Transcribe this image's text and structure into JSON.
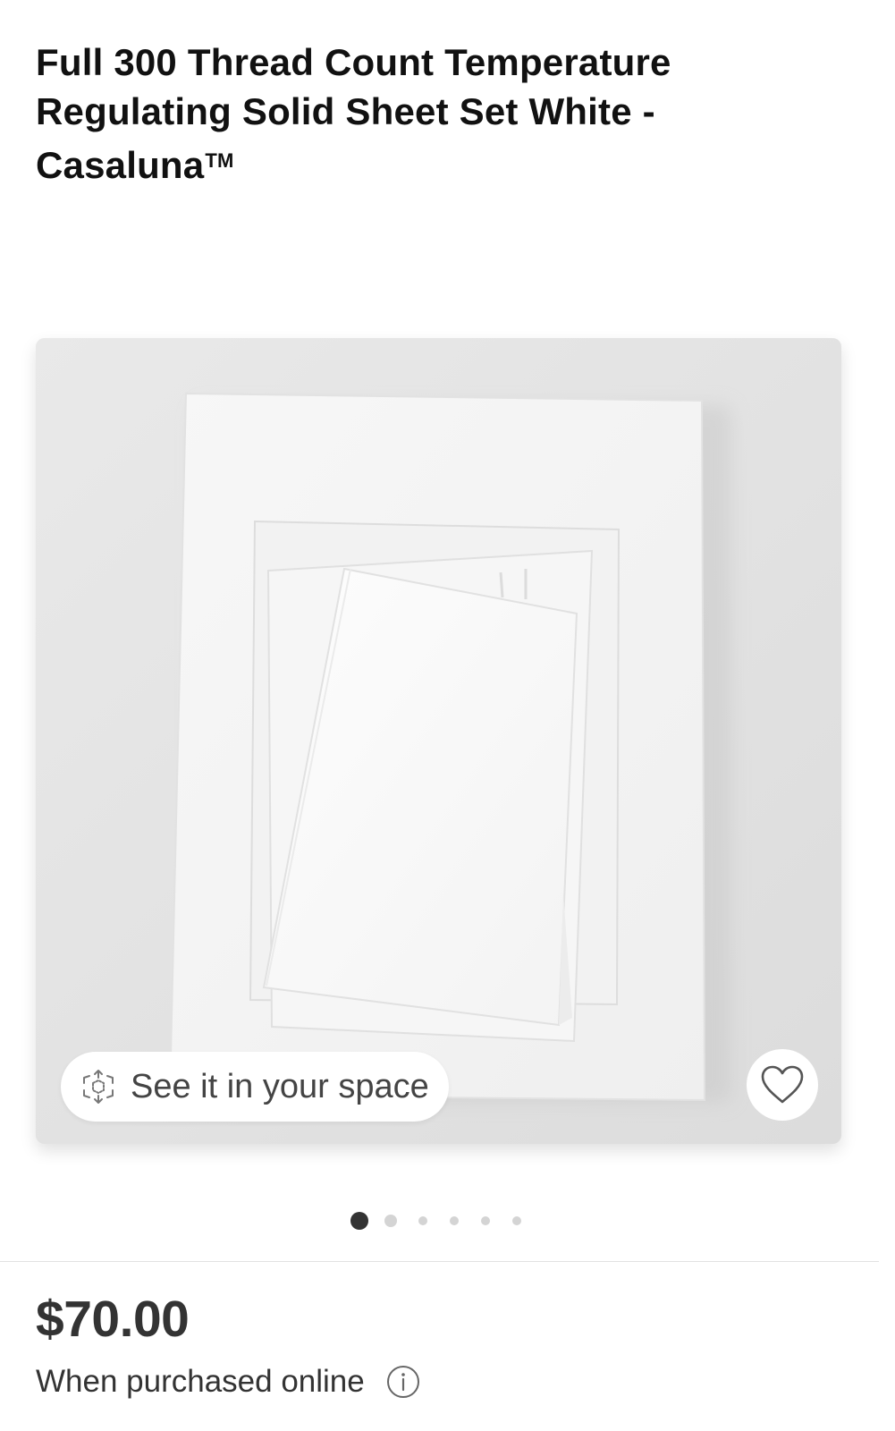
{
  "product": {
    "title": "Full 300 Thread Count Temperature Regulating Solid Sheet Set White - Casaluna",
    "trademark": "TM"
  },
  "gallery": {
    "image_alt": "White folded sheet set",
    "ar_button_label": "See it in your space",
    "ar_icon": "ar-cube-icon",
    "favorite_icon": "heart-outline-icon",
    "slide_count": 6,
    "active_slide": 1
  },
  "pricing": {
    "price": "$70.00",
    "note": "When purchased online",
    "info_icon": "info-circle-icon"
  },
  "colors": {
    "active_dot": "#333333",
    "inactive_dot": "#d4d4d4",
    "image_background": "#e4e4e4"
  }
}
